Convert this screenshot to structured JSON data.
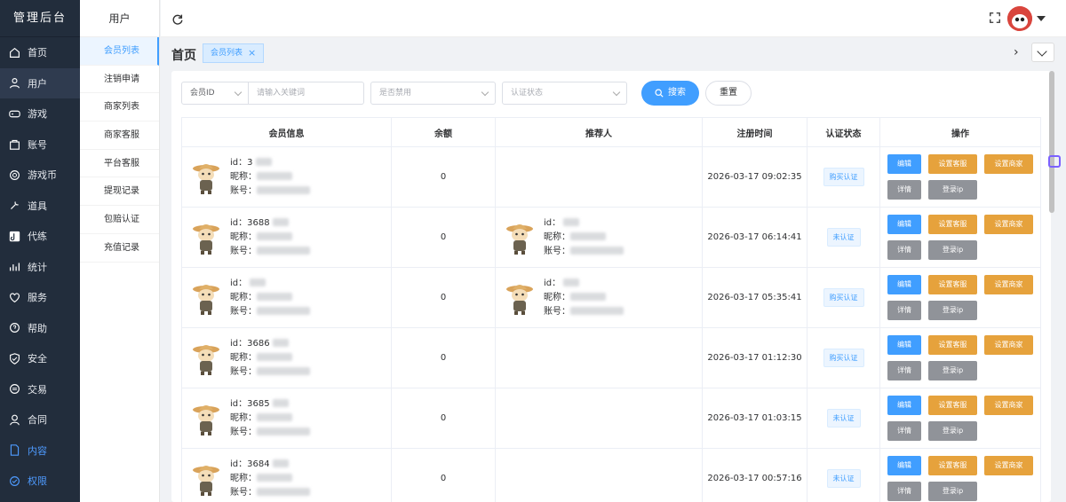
{
  "app_title": "管理后台",
  "sidebar": [
    {
      "label": "首页",
      "icon": "home-icon"
    },
    {
      "label": "用户",
      "icon": "user-icon",
      "active": true
    },
    {
      "label": "游戏",
      "icon": "gamepad-icon"
    },
    {
      "label": "账号",
      "icon": "bag-icon"
    },
    {
      "label": "游戏币",
      "icon": "coin-icon"
    },
    {
      "label": "道具",
      "icon": "tool-icon"
    },
    {
      "label": "代练",
      "icon": "tiktok-icon"
    },
    {
      "label": "统计",
      "icon": "chart-icon"
    },
    {
      "label": "服务",
      "icon": "heart-icon"
    },
    {
      "label": "帮助",
      "icon": "question-icon"
    },
    {
      "label": "安全",
      "icon": "shield-icon"
    },
    {
      "label": "交易",
      "icon": "exchange-icon"
    },
    {
      "label": "合同",
      "icon": "person-icon"
    },
    {
      "label": "内容",
      "icon": "document-icon",
      "highlight": true
    },
    {
      "label": "权限",
      "icon": "check-circle-icon",
      "highlight": true
    }
  ],
  "submenu": {
    "title": "用户",
    "items": [
      "会员列表",
      "注销申请",
      "商家列表",
      "商家客服",
      "平台客服",
      "提现记录",
      "包赔认证",
      "充值记录"
    ]
  },
  "breadcrumb": {
    "home": "首页",
    "tag": "会员列表",
    "close": "×"
  },
  "filters": {
    "field_select": "会员ID",
    "keyword_placeholder": "请输入关键词",
    "disabled_select": "是否禁用",
    "auth_select": "认证状态",
    "search_button": "搜索",
    "reset_button": "重置"
  },
  "table": {
    "headers": [
      "会员信息",
      "余额",
      "推荐人",
      "注册时间",
      "认证状态",
      "操作"
    ],
    "rows": [
      {
        "id": "3",
        "nickname": "",
        "account": "",
        "balance": "0",
        "referrer": null,
        "time": "2026-03-17 09:02:35",
        "status": "购买认证"
      },
      {
        "id": "3688",
        "nickname": "",
        "account": "",
        "balance": "0",
        "referrer": {
          "id": "",
          "nickname": "",
          "account": ""
        },
        "time": "2026-03-17 06:14:41",
        "status": "未认证"
      },
      {
        "id": "",
        "nickname": "",
        "account": "",
        "balance": "0",
        "referrer": {
          "id": "",
          "nickname": "",
          "account": ""
        },
        "time": "2026-03-17 05:35:41",
        "status": "购买认证"
      },
      {
        "id": "3686",
        "nickname": "",
        "account": "",
        "balance": "0",
        "referrer": null,
        "time": "2026-03-17 01:12:30",
        "status": "购买认证"
      },
      {
        "id": "3685",
        "nickname": "",
        "account": "",
        "balance": "0",
        "referrer": null,
        "time": "2026-03-17 01:03:15",
        "status": "未认证"
      },
      {
        "id": "3684",
        "nickname": "",
        "account": "",
        "balance": "0",
        "referrer": null,
        "time": "2026-03-17 00:57:16",
        "status": "未认证"
      }
    ],
    "labels": {
      "id": "id：",
      "nickname": "昵称：",
      "account": "账号："
    },
    "ops": {
      "edit": "编辑",
      "set_cs": "设置客服",
      "set_merchant": "设置商家",
      "detail": "详情",
      "login_ip": "登录ip"
    }
  }
}
